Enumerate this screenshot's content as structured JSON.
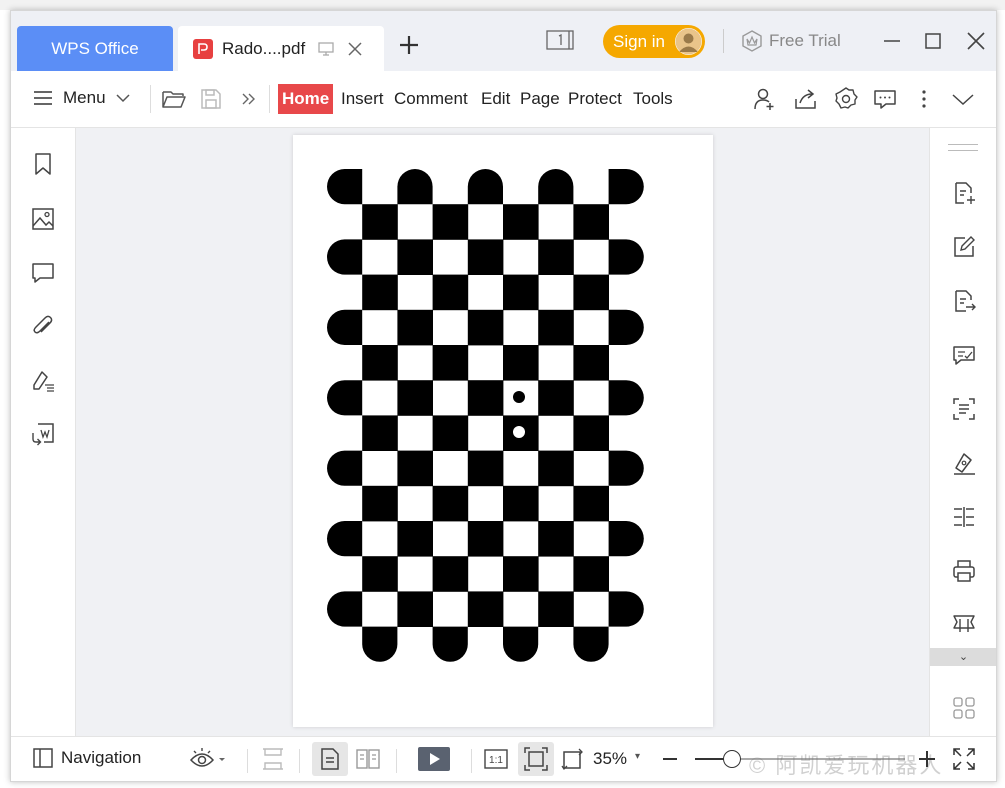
{
  "titlebar": {
    "app_tab": "WPS Office",
    "doc_tab_title": "Rado....pdf",
    "signin_label": "Sign in",
    "free_trial_label": "Free Trial"
  },
  "toolbar": {
    "menu_label": "Menu",
    "tabs": [
      "Home",
      "Insert",
      "Comment",
      "Edit",
      "Page",
      "Protect",
      "Tools"
    ],
    "active_tab": "Home"
  },
  "statusbar": {
    "navigation_label": "Navigation",
    "zoom_label": "35%",
    "zoom_fraction": 0.17
  },
  "watermark": "© 阿凯爱玩机器人",
  "icons": {
    "left_sidebar": [
      "bookmark-icon",
      "image-icon",
      "comment-icon",
      "attachment-icon",
      "sign-icon",
      "convert-icon"
    ],
    "right_sidebar": [
      "pdf-to-word-icon",
      "edit-pdf-icon",
      "export-icon",
      "annotate-icon",
      "ocr-icon",
      "signature-icon",
      "compare-icon",
      "print-icon",
      "scan-icon",
      "apps-icon"
    ]
  },
  "document": {
    "pattern": "checkerboard calibration target",
    "grid_columns": 9,
    "grid_rows": 14,
    "colors": {
      "dark": "#000000",
      "light": "#ffffff"
    }
  },
  "colors": {
    "accent_blue": "#5b8ef6",
    "home_red": "#e8484a",
    "signin_orange": "#f5a800"
  }
}
